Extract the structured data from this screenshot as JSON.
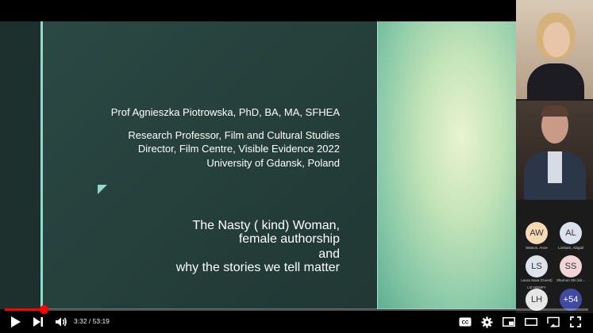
{
  "slide": {
    "presenter_name": "Prof Agnieszka Piotrowska, PhD, BA, MA, SFHEA",
    "roles": [
      "Research Professor, Film and Cultural Studies",
      "Director, Film Centre, Visible Evidence 2022",
      "University of Gdansk, Poland"
    ],
    "title_lines": [
      "The Nasty ( kind) Woman,",
      "female authorship",
      "and",
      "why the stories we tell matter"
    ]
  },
  "participants": {
    "avatars": [
      {
        "initials": "AW",
        "name": "Watson, Anne",
        "color": "#f3d9b4"
      },
      {
        "initials": "AL",
        "name": "Lonham, Abigail",
        "color": "#dbe2ee"
      },
      {
        "initials": "LS",
        "name": "Laura Sava (Guest)",
        "color": "#dce3ec"
      },
      {
        "initials": "SS",
        "name": "Shumon SN (ick...",
        "color": "#f0d4d6"
      },
      {
        "initials": "LH",
        "name": "LIZ HENRY",
        "color": "#e6e6e6"
      },
      {
        "initials": "+54",
        "name": "",
        "color": "#3f4aa0"
      }
    ]
  },
  "player": {
    "current_time": "3:32",
    "duration": "53:19",
    "time_display": "3:32 / 53:19",
    "progress": 0.066,
    "accent_color": "#ff0000"
  },
  "controls": {
    "play_icon": "play-icon",
    "next_icon": "next-icon",
    "volume_icon": "volume-icon",
    "cc_label": "CC"
  }
}
